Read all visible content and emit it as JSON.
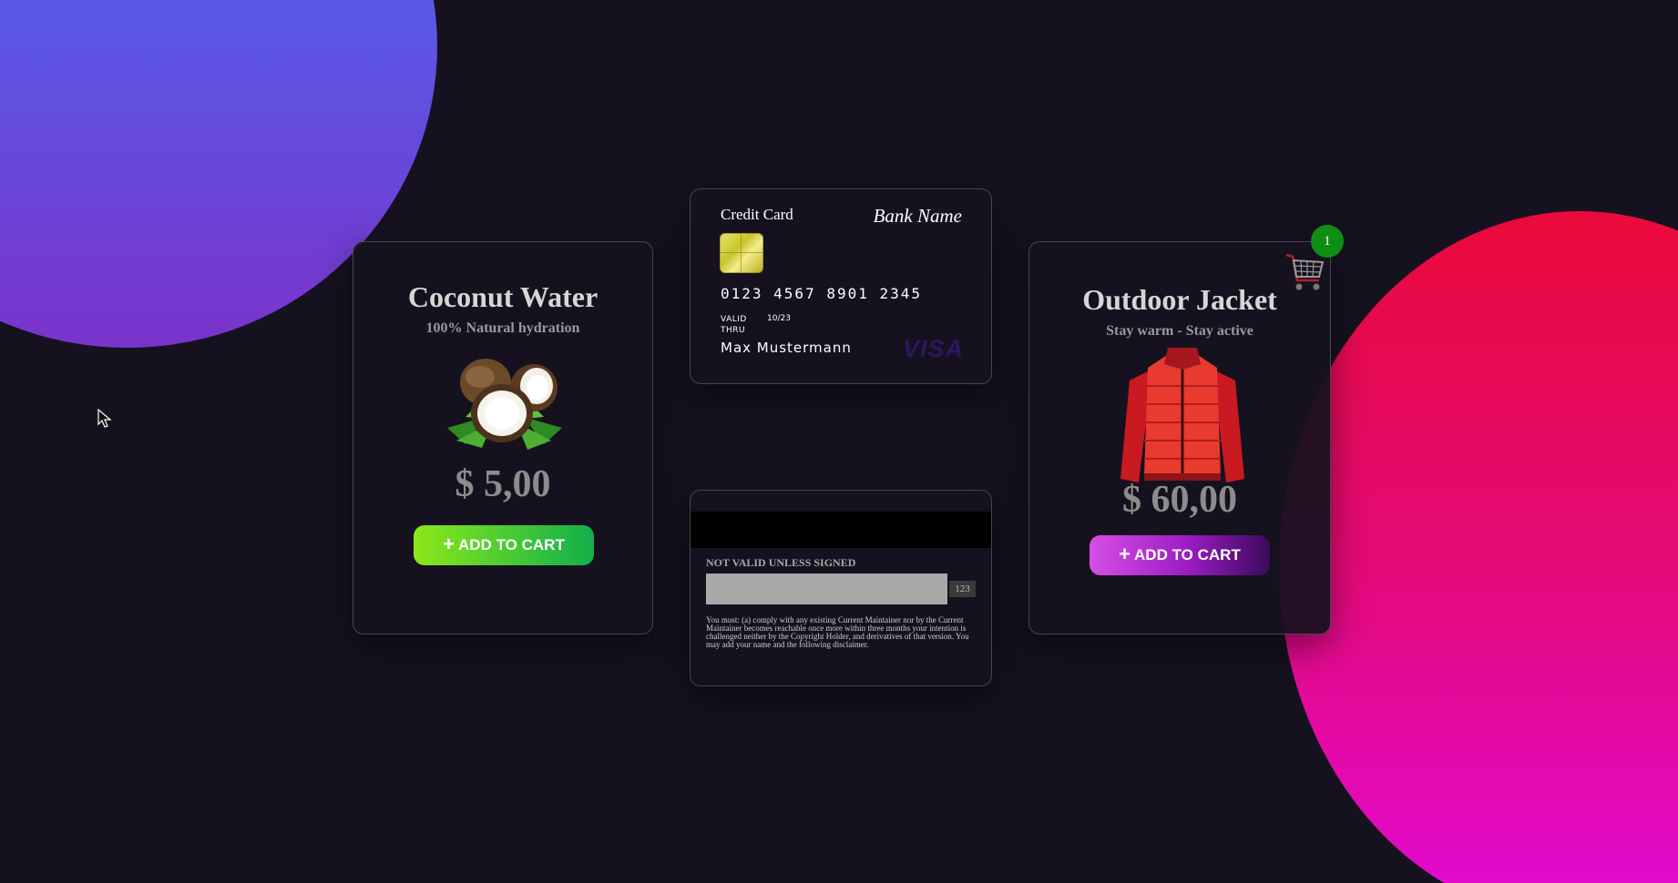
{
  "products": {
    "coconut": {
      "title": "Coconut Water",
      "subtitle": "100% Natural hydration",
      "price": "$ 5,00",
      "button_label": "ADD TO CART",
      "button_gradient": [
        "#8be81a",
        "#10b04a"
      ]
    },
    "jacket": {
      "title": "Outdoor Jacket",
      "subtitle": "Stay warm - Stay active",
      "price": "$ 60,00",
      "button_label": "ADD TO CART",
      "button_gradient": [
        "#d84ee6",
        "#3a0a5a"
      ]
    }
  },
  "credit_card": {
    "front": {
      "label": "Credit Card",
      "bank_name": "Bank Name",
      "number": "0123 4567 8901 2345",
      "valid_thru_label": "VALID THRU",
      "valid_date": "10/23",
      "holder": "Max Mustermann",
      "brand": "VISA"
    },
    "back": {
      "signature_label": "NOT VALID UNLESS SIGNED",
      "cvv": "123",
      "disclaimer": "You must: (a) comply with any existing Current Maintainer nor by the Current Maintainer becomes reachable once more within three months your intention is challenged neither by the Copyright Holder, and derivatives of that version. You may add your name and the following disclaimer."
    }
  },
  "cart": {
    "count": "1",
    "badge_color": "#0f8f12"
  },
  "colors": {
    "background": "#16111f",
    "blob_blue": [
      "#4a66ee",
      "#7a33cc"
    ],
    "blob_pink": [
      "#ea0a3a",
      "#e20ad6"
    ]
  },
  "icons": {
    "cart": "shopping-cart-icon",
    "cursor": "mouse-pointer-icon",
    "plus": "plus-icon"
  }
}
